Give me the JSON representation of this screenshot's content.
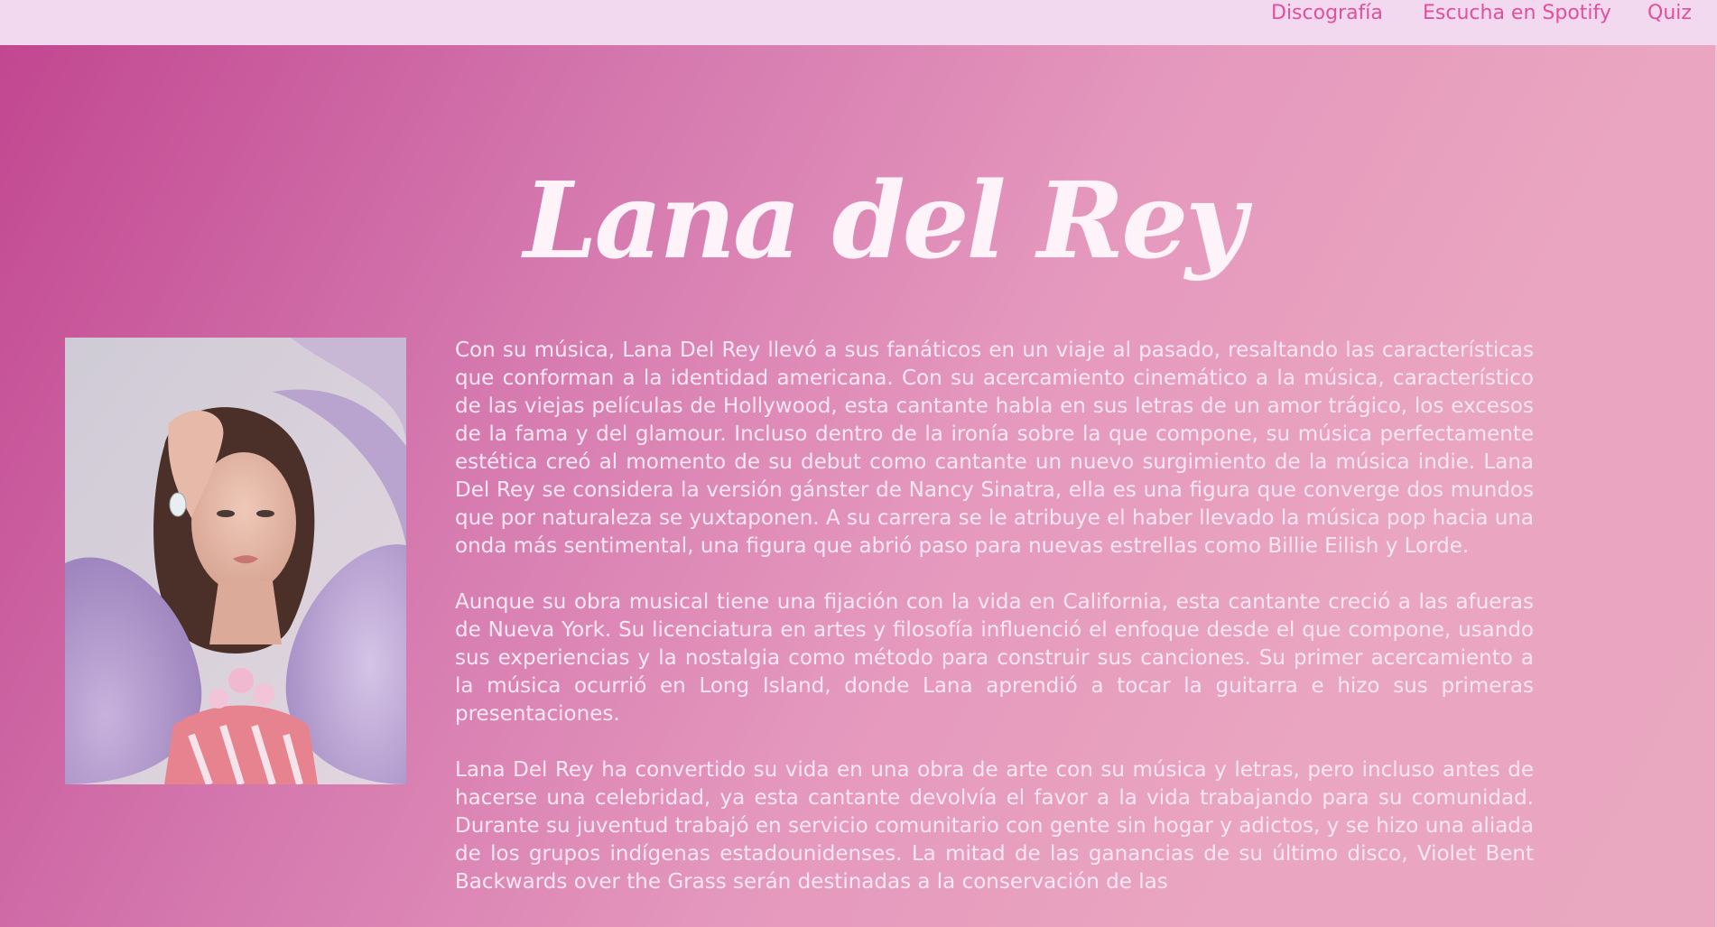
{
  "nav": {
    "items": [
      {
        "label": "Discografía"
      },
      {
        "label": "Escucha en Spotify"
      },
      {
        "label": "Quiz"
      }
    ]
  },
  "hero": {
    "title": "Lana del Rey"
  },
  "portrait": {
    "icon": "portrait-photo"
  },
  "article": {
    "paragraphs": [
      "Con su música, Lana Del Rey llevó a sus fanáticos en un viaje al pasado, resaltando las características que conforman a la identidad americana. Con su acercamiento cinemático a la música, característico de las viejas películas de Hollywood, esta cantante habla en sus letras de un amor trágico, los excesos de la fama y del glamour. Incluso dentro de la ironía sobre la que compone, su música perfectamente estética creó al momento de su debut como cantante un nuevo surgimiento de la música indie. Lana Del Rey se considera la versión gánster de Nancy Sinatra, ella es una figura que converge dos mundos que por naturaleza se yuxtaponen. A su carrera se le atribuye el haber llevado la música pop hacia una onda más sentimental, una figura que abrió paso para nuevas estrellas como Billie Eilish y Lorde.",
      "Aunque su obra musical tiene una fijación con la vida en California, esta cantante creció a las afueras de Nueva York. Su licenciatura en artes y filosofía influenció el enfoque desde el que compone, usando sus experiencias y la nostalgia como método para construir sus canciones. Su primer acercamiento a la música ocurrió en Long Island, donde Lana aprendió a tocar la guitarra e hizo sus primeras presentaciones.",
      "Lana Del Rey ha convertido su vida en una obra de arte con su música y letras, pero incluso antes de hacerse una celebridad, ya esta cantante devolvía el favor a la vida trabajando para su comunidad. Durante su juventud trabajó en servicio comunitario con gente sin hogar y adictos, y se hizo una aliada de los grupos indígenas estadounidenses. La mitad de las ganancias de su último disco, Violet Bent Backwards over the Grass serán destinadas a la conservación de las"
    ]
  },
  "colors": {
    "nav_bg": "#f3d9ef",
    "nav_text": "#e24f9d",
    "gradient_start": "#c1458f",
    "gradient_end": "#eaa7c0",
    "body_text": "#fbe7f2"
  }
}
